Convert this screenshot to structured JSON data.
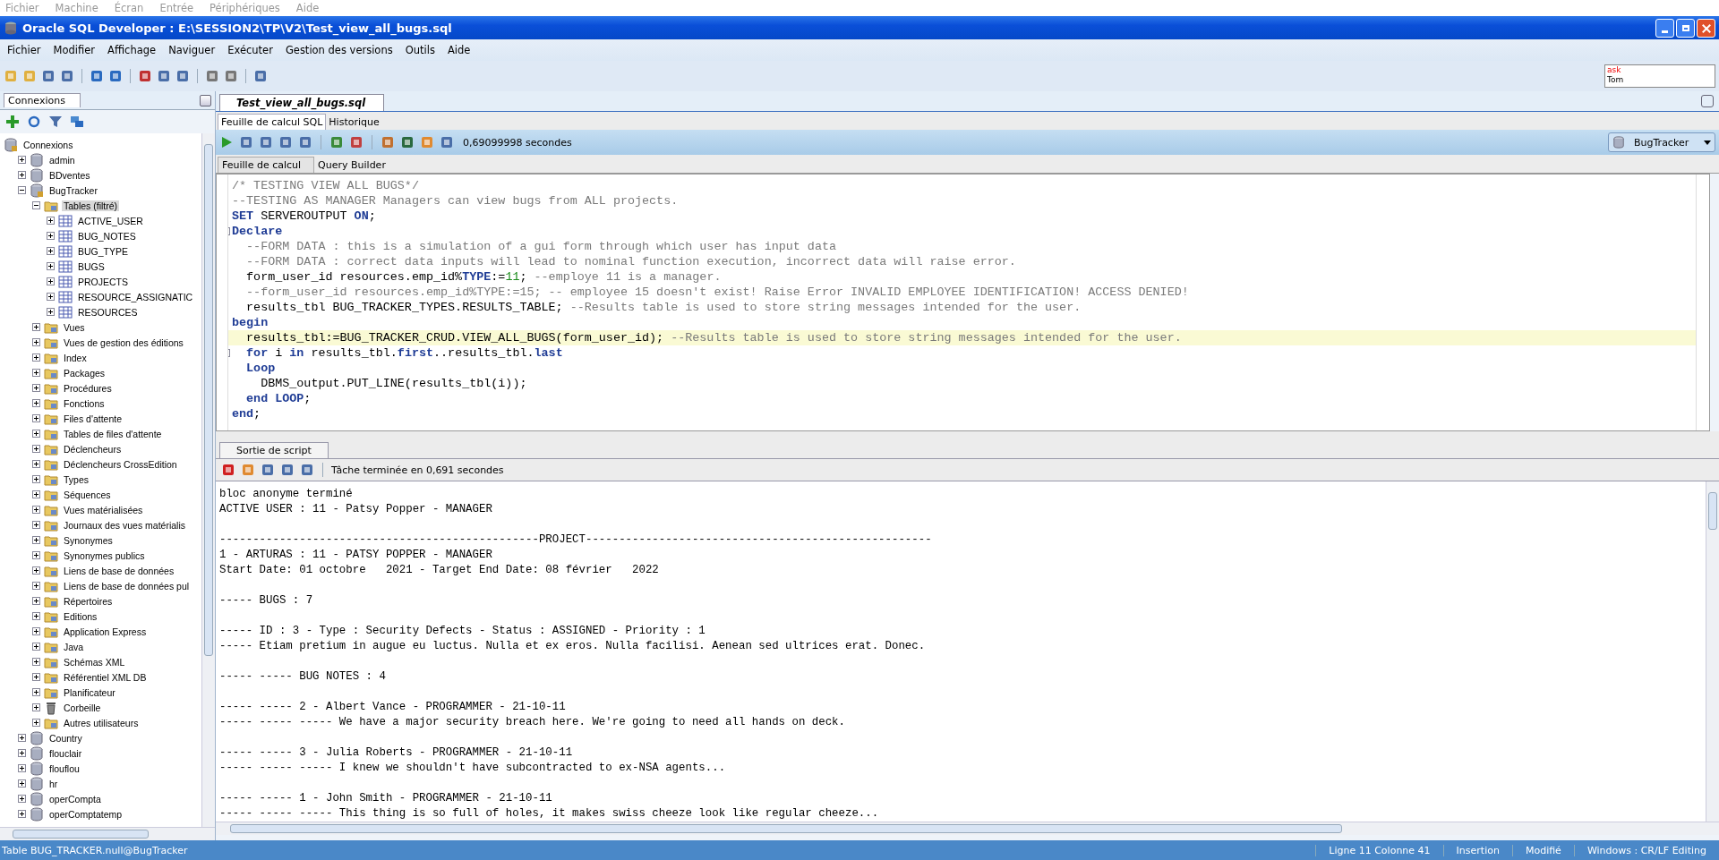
{
  "host_menu": [
    "Fichier",
    "Machine",
    "Écran",
    "Entrée",
    "Périphériques",
    "Aide"
  ],
  "window": {
    "title": "Oracle SQL Developer : E:\\SESSION2\\TP\\V2\\Test_view_all_bugs.sql"
  },
  "menu": [
    "Fichier",
    "Modifier",
    "Affichage",
    "Naviguer",
    "Exécuter",
    "Gestion des versions",
    "Outils",
    "Aide"
  ],
  "ask_tom": {
    "line_1": "ask",
    "line_2": "Tom"
  },
  "connections_panel": {
    "title": "Connexions",
    "tree": [
      {
        "label": "Connexions",
        "kind": "connections",
        "selected": false,
        "children": [
          {
            "label": "admin",
            "kind": "database",
            "expanded": false,
            "selected": false
          },
          {
            "label": "BDventes",
            "kind": "database",
            "expanded": false,
            "selected": false
          },
          {
            "label": "BugTracker",
            "kind": "connection",
            "expanded": true,
            "selected": false,
            "children": [
              {
                "label": "Tables (filtré)",
                "kind": "folder",
                "expanded": true,
                "selected": true,
                "children": [
                  {
                    "label": "ACTIVE_USER",
                    "kind": "table",
                    "expanded": false,
                    "selected": false
                  },
                  {
                    "label": "BUG_NOTES",
                    "kind": "table",
                    "expanded": false,
                    "selected": false
                  },
                  {
                    "label": "BUG_TYPE",
                    "kind": "table",
                    "expanded": false,
                    "selected": false
                  },
                  {
                    "label": "BUGS",
                    "kind": "table",
                    "expanded": false,
                    "selected": false
                  },
                  {
                    "label": "PROJECTS",
                    "kind": "table",
                    "expanded": false,
                    "selected": false
                  },
                  {
                    "label": "RESOURCE_ASSIGNATIC",
                    "kind": "table",
                    "expanded": false,
                    "selected": false
                  },
                  {
                    "label": "RESOURCES",
                    "kind": "table",
                    "expanded": false,
                    "selected": false
                  }
                ]
              },
              {
                "label": "Vues",
                "kind": "folder",
                "expanded": false,
                "selected": false
              },
              {
                "label": "Vues de gestion des éditions",
                "kind": "folder",
                "expanded": false,
                "selected": false
              },
              {
                "label": "Index",
                "kind": "folder",
                "expanded": false,
                "selected": false
              },
              {
                "label": "Packages",
                "kind": "folder",
                "expanded": false,
                "selected": false
              },
              {
                "label": "Procédures",
                "kind": "folder",
                "expanded": false,
                "selected": false
              },
              {
                "label": "Fonctions",
                "kind": "folder",
                "expanded": false,
                "selected": false
              },
              {
                "label": "Files d'attente",
                "kind": "folder",
                "expanded": false,
                "selected": false
              },
              {
                "label": "Tables de files d'attente",
                "kind": "folder",
                "expanded": false,
                "selected": false
              },
              {
                "label": "Déclencheurs",
                "kind": "folder",
                "expanded": false,
                "selected": false
              },
              {
                "label": "Déclencheurs CrossEdition",
                "kind": "folder",
                "expanded": false,
                "selected": false
              },
              {
                "label": "Types",
                "kind": "folder",
                "expanded": false,
                "selected": false
              },
              {
                "label": "Séquences",
                "kind": "folder",
                "expanded": false,
                "selected": false
              },
              {
                "label": "Vues matérialisées",
                "kind": "folder",
                "expanded": false,
                "selected": false
              },
              {
                "label": "Journaux des vues matérialis",
                "kind": "folder",
                "expanded": false,
                "selected": false
              },
              {
                "label": "Synonymes",
                "kind": "folder",
                "expanded": false,
                "selected": false
              },
              {
                "label": "Synonymes publics",
                "kind": "folder",
                "expanded": false,
                "selected": false
              },
              {
                "label": "Liens de base de données",
                "kind": "folder",
                "expanded": false,
                "selected": false
              },
              {
                "label": "Liens de base de données pul",
                "kind": "folder",
                "expanded": false,
                "selected": false
              },
              {
                "label": "Répertoires",
                "kind": "folder",
                "expanded": false,
                "selected": false
              },
              {
                "label": "Editions",
                "kind": "folder",
                "expanded": false,
                "selected": false
              },
              {
                "label": "Application Express",
                "kind": "folder",
                "expanded": false,
                "selected": false
              },
              {
                "label": "Java",
                "kind": "folder",
                "expanded": false,
                "selected": false
              },
              {
                "label": "Schémas XML",
                "kind": "folder",
                "expanded": false,
                "selected": false
              },
              {
                "label": "Référentiel XML DB",
                "kind": "folder",
                "expanded": false,
                "selected": false
              },
              {
                "label": "Planificateur",
                "kind": "folder",
                "expanded": false,
                "selected": false
              },
              {
                "label": "Corbeille",
                "kind": "trash",
                "expanded": false,
                "selected": false
              },
              {
                "label": "Autres utilisateurs",
                "kind": "folder",
                "expanded": false,
                "selected": false
              }
            ]
          },
          {
            "label": "Country",
            "kind": "database",
            "expanded": false,
            "selected": false
          },
          {
            "label": "flouclair",
            "kind": "database",
            "expanded": false,
            "selected": false
          },
          {
            "label": "flouflou",
            "kind": "database",
            "expanded": false,
            "selected": false
          },
          {
            "label": "hr",
            "kind": "database",
            "expanded": false,
            "selected": false
          },
          {
            "label": "operCompta",
            "kind": "database",
            "expanded": false,
            "selected": false
          },
          {
            "label": "operComptatemp",
            "kind": "database",
            "expanded": false,
            "selected": false
          }
        ]
      }
    ]
  },
  "editor": {
    "tab": "Test_view_all_bugs.sql",
    "subtabs": [
      {
        "label": "Feuille de calcul SQL",
        "selected": true
      },
      {
        "label": "Historique",
        "selected": false
      }
    ],
    "elapsed": "0,69099998 secondes",
    "connection": "BugTracker",
    "inner_tabs": [
      {
        "label": "Feuille de calcul",
        "selected": true
      },
      {
        "label": "Query Builder",
        "selected": false
      }
    ],
    "lines": [
      {
        "fold_marker": false,
        "current": false,
        "tokens": [
          {
            "text": "/* TESTING VIEW ALL BUGS*/",
            "kind": "comment"
          }
        ]
      },
      {
        "fold_marker": false,
        "current": false,
        "tokens": [
          {
            "text": "--TESTING AS MANAGER Managers can view bugs from ALL projects.",
            "kind": "comment"
          }
        ]
      },
      {
        "fold_marker": false,
        "current": false,
        "tokens": [
          {
            "text": "SET",
            "kind": "keyword"
          },
          {
            "text": " SERVEROUTPUT ",
            "kind": "plain"
          },
          {
            "text": "ON",
            "kind": "keyword"
          },
          {
            "text": ";",
            "kind": "plain"
          }
        ]
      },
      {
        "fold_marker": true,
        "current": false,
        "tokens": [
          {
            "text": "Declare",
            "kind": "keyword"
          }
        ]
      },
      {
        "fold_marker": false,
        "current": false,
        "tokens": [
          {
            "text": "  --FORM DATA : this is a simulation of a gui form through which user has input data",
            "kind": "comment"
          }
        ]
      },
      {
        "fold_marker": false,
        "current": false,
        "tokens": [
          {
            "text": "  --FORM DATA : correct data inputs will lead to nominal function execution, incorrect data will raise error.",
            "kind": "comment"
          }
        ]
      },
      {
        "fold_marker": false,
        "current": false,
        "tokens": [
          {
            "text": "  form_user_id resources.emp_id%",
            "kind": "plain"
          },
          {
            "text": "TYPE",
            "kind": "keyword"
          },
          {
            "text": ":=",
            "kind": "plain"
          },
          {
            "text": "11",
            "kind": "number"
          },
          {
            "text": "; ",
            "kind": "plain"
          },
          {
            "text": "--employe 11 is a manager.",
            "kind": "comment"
          }
        ]
      },
      {
        "fold_marker": false,
        "current": false,
        "tokens": [
          {
            "text": "  --form_user_id resources.emp_id%TYPE:=15; -- employee 15 doesn't exist! Raise Error INVALID EMPLOYEE IDENTIFICATION! ACCESS DENIED!",
            "kind": "comment"
          }
        ]
      },
      {
        "fold_marker": false,
        "current": false,
        "tokens": [
          {
            "text": "  results_tbl BUG_TRACKER_TYPES.RESULTS_TABLE; ",
            "kind": "plain"
          },
          {
            "text": "--Results table is used to store string messages intended for the user.",
            "kind": "comment"
          }
        ]
      },
      {
        "fold_marker": false,
        "current": false,
        "tokens": [
          {
            "text": "begin",
            "kind": "keyword"
          }
        ]
      },
      {
        "fold_marker": false,
        "current": true,
        "tokens": [
          {
            "text": "  results_tbl:=BUG_TRACKER_CRUD.VIEW_ALL_BUGS(form_user_id); ",
            "kind": "plain"
          },
          {
            "text": "--Results table is used to store string messages intended for the user.",
            "kind": "comment"
          }
        ]
      },
      {
        "fold_marker": true,
        "current": false,
        "tokens": [
          {
            "text": "  for",
            "kind": "keyword"
          },
          {
            "text": " i ",
            "kind": "plain"
          },
          {
            "text": "in",
            "kind": "keyword"
          },
          {
            "text": " results_tbl.",
            "kind": "plain"
          },
          {
            "text": "first",
            "kind": "keyword"
          },
          {
            "text": "..results_tbl.",
            "kind": "plain"
          },
          {
            "text": "last",
            "kind": "keyword"
          }
        ]
      },
      {
        "fold_marker": false,
        "current": false,
        "tokens": [
          {
            "text": "  Loop",
            "kind": "keyword"
          }
        ]
      },
      {
        "fold_marker": false,
        "current": false,
        "tokens": [
          {
            "text": "    DBMS_output.PUT_LINE(results_tbl(i));",
            "kind": "plain"
          }
        ]
      },
      {
        "fold_marker": false,
        "current": false,
        "tokens": [
          {
            "text": "  end LOOP",
            "kind": "keyword"
          },
          {
            "text": ";",
            "kind": "plain"
          }
        ]
      },
      {
        "fold_marker": false,
        "current": false,
        "tokens": [
          {
            "text": "end",
            "kind": "keyword"
          },
          {
            "text": ";",
            "kind": "plain"
          }
        ]
      }
    ]
  },
  "script_output": {
    "tab": "Sortie de script",
    "status": "Tâche terminée en 0,691 secondes",
    "blocks": [
      [
        "bloc anonyme terminé",
        "ACTIVE USER : 11 - Patsy Popper - MANAGER"
      ],
      [
        "------------------------------------------------PROJECT----------------------------------------------------",
        "1 - ARTURAS : 11 - PATSY POPPER - MANAGER",
        "Start Date: 01 octobre   2021 - Target End Date: 08 février   2022"
      ],
      [
        "----- BUGS : 7"
      ],
      [
        "----- ID : 3 - Type : Security Defects - Status : ASSIGNED - Priority : 1",
        "----- Etiam pretium in augue eu luctus. Nulla et ex eros. Nulla facilisi. Aenean sed ultrices erat. Donec."
      ],
      [
        "----- ----- BUG NOTES : 4"
      ],
      [
        "----- ----- 2 - Albert Vance - PROGRAMMER - 21-10-11",
        "----- ----- ----- We have a major security breach here. We're going to need all hands on deck."
      ],
      [
        "----- ----- 3 - Julia Roberts - PROGRAMMER - 21-10-11",
        "----- ----- ----- I knew we shouldn't have subcontracted to ex-NSA agents..."
      ],
      [
        "----- ----- 1 - John Smith - PROGRAMMER - 21-10-11",
        "----- ----- ----- This thing is so full of holes, it makes swiss cheeze look like regular cheeze..."
      ]
    ]
  },
  "status_bar": [
    "Table BUG_TRACKER.null@BugTracker",
    "Ligne 11 Colonne 41",
    "Insertion",
    "Modifié",
    "Windows : CR/LF Editing"
  ]
}
